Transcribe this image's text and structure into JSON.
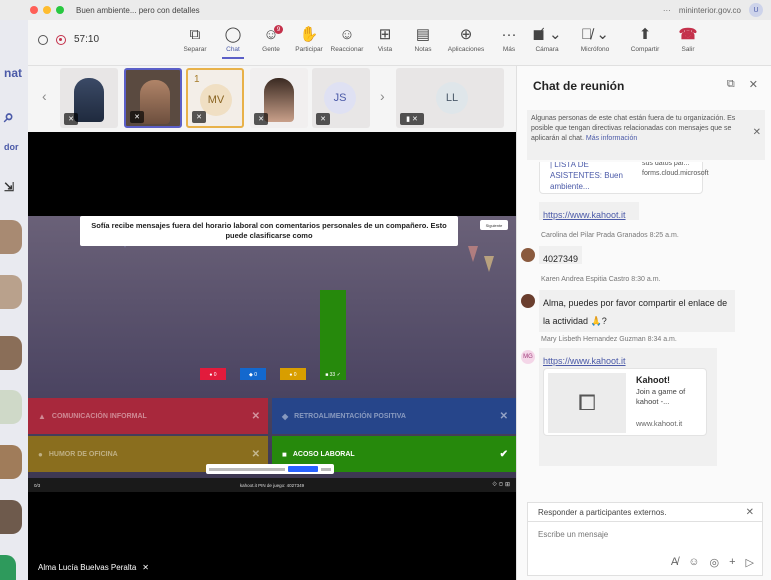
{
  "window": {
    "title": "Buen ambiente... pero con detalles",
    "url": "mininterior.gov.co",
    "user_initial": "U"
  },
  "left_edge": {
    "fragments": [
      "nat",
      "dor"
    ]
  },
  "toolbar": {
    "timer": "57:10",
    "tools": [
      {
        "label": "Separar",
        "icon": "separate-icon"
      },
      {
        "label": "Chat",
        "icon": "chat-icon"
      },
      {
        "label": "Gente",
        "icon": "people-icon",
        "badge": "9"
      },
      {
        "label": "Participar",
        "icon": "raise-hand-icon"
      },
      {
        "label": "Reaccionar",
        "icon": "react-icon"
      },
      {
        "label": "Vista",
        "icon": "view-icon"
      },
      {
        "label": "Notas",
        "icon": "notes-icon"
      },
      {
        "label": "Aplicaciones",
        "icon": "apps-icon"
      },
      {
        "label": "Más",
        "icon": "more-icon"
      }
    ],
    "camera_label": "Cámara",
    "mic_label": "Micrófono",
    "share_label": "Compartir",
    "leave_label": "Salir"
  },
  "participants": [
    {
      "type": "photo"
    },
    {
      "type": "photo",
      "selected": true
    },
    {
      "type": "initials",
      "initials": "MV",
      "count": "1"
    },
    {
      "type": "photo"
    },
    {
      "type": "initials",
      "initials": "JS"
    },
    {
      "type": "initials",
      "initials": "LL"
    }
  ],
  "presentation": {
    "question": "Sofía recibe mensajes fuera del horario laboral con comentarios personales de un compañero. Esto puede clasificarse como",
    "skip_label": "Siguiente",
    "bars": [
      {
        "label": "● 0",
        "color": "#e21b3c",
        "value": 2
      },
      {
        "label": "◆ 0",
        "color": "#1368ce",
        "value": 1
      },
      {
        "label": "● 0",
        "color": "#d89e00",
        "value": 1
      },
      {
        "label": "■ 33 ✓",
        "color": "#26890c",
        "value": 33
      }
    ],
    "answers": [
      {
        "label": "COMUNICACIÓN INFORMAL",
        "shape": "▲",
        "color": "#a8283c",
        "correct": false
      },
      {
        "label": "RETROALIMENTACIÓN POSITIVA",
        "shape": "◆",
        "color": "#26458a",
        "correct": false
      },
      {
        "label": "HUMOR DE OFICINA",
        "shape": "●",
        "color": "#8a6e1e",
        "correct": false
      },
      {
        "label": "ACOSO LABORAL",
        "shape": "■",
        "color": "#26890c",
        "correct": true
      }
    ],
    "footer_left": "0/3",
    "footer_center": "kahoot.it  PIN de juego: 4027349",
    "footer_right": "⟐ ⊙ ⊞",
    "presenter": "Alma Lucía Buelvas Peralta"
  },
  "chat": {
    "title": "Chat de reunión",
    "notice": "Algunas personas de este chat están fuera de tu organización. Es posible que tengan directivas relacionadas con mensajes que se aplicarán al chat.",
    "notice_link": "Más información",
    "card1_left": "| LISTA DE ASISTENTES: Buen ambiente...",
    "card1_right": "sus datos par... forms.cloud.microsoft",
    "link1": "https://www.kahoot.it",
    "messages": [
      {
        "author": "Carolina del Pilar Prada Granados",
        "time": "8:25 a.m.",
        "text": "4027349"
      },
      {
        "author": "Karen Andrea Espitia Castro",
        "time": "8:30 a.m.",
        "text": "Alma, puedes por favor compartir el enlace de la actividad 🙏?"
      },
      {
        "author": "Mary Lisbeth Hernandez Guzman",
        "time": "8:34 a.m.",
        "initials": "MG",
        "link": "https://www.kahoot.it"
      }
    ],
    "preview": {
      "title": "Kahoot!",
      "desc": "Join a game of kahoot -...",
      "domain": "www.kahoot.it"
    },
    "reply_label": "Responder a participantes externos.",
    "compose_placeholder": "Escribe un mensaje"
  },
  "colors": {
    "accent": "#5b5fc7",
    "leave": "#c4314b"
  }
}
